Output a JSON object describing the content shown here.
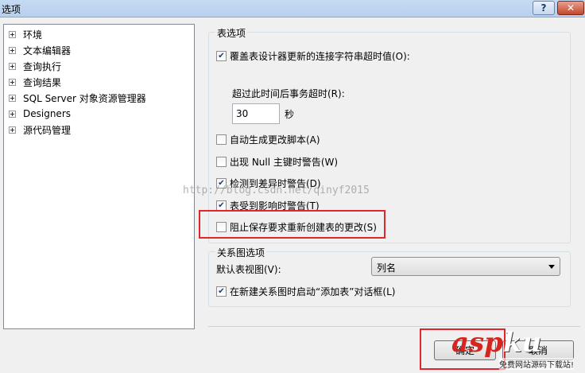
{
  "window": {
    "title": "选项",
    "help_label": "?",
    "close_label": "✕"
  },
  "tree": {
    "items": [
      {
        "label": "环境"
      },
      {
        "label": "文本编辑器"
      },
      {
        "label": "查询执行"
      },
      {
        "label": "查询结果"
      },
      {
        "label": "SQL Server 对象资源管理器"
      },
      {
        "label": "Designers"
      },
      {
        "label": "源代码管理"
      }
    ]
  },
  "table_options": {
    "group_title": "表选项",
    "override_connection_timeout": {
      "label": "覆盖表设计器更新的连接字符串超时值(O):",
      "checked": true
    },
    "timeout_label": "超过此时间后事务超时(R):",
    "timeout_value": "30",
    "timeout_unit": "秒",
    "auto_generate_scripts": {
      "label": "自动生成更改脚本(A)",
      "checked": false
    },
    "null_pk_warning": {
      "label": "出现 Null 主键时警告(W)",
      "checked": false
    },
    "diff_warning": {
      "label": "检测到差异时警告(D)",
      "checked": true
    },
    "affected_tables_warning": {
      "label": "表受到影响时警告(T)",
      "checked": true
    },
    "prevent_saving_changes": {
      "label": "阻止保存要求重新创建表的更改(S)",
      "checked": false
    }
  },
  "diagram_options": {
    "group_title": "关系图选项",
    "default_view_label": "默认表视图(V):",
    "default_view_value": "列名",
    "launch_add_table": {
      "label": "在新建关系图时启动“添加表”对话框(L)",
      "checked": true
    }
  },
  "buttons": {
    "ok_label": "确定",
    "cancel_label": "取消"
  },
  "watermark": {
    "text": "http://blog.csdn.net/qinyf2015"
  },
  "logo": {
    "part1": "asp",
    "part2": "ku",
    "tagline": "免费网站源码下载站!"
  },
  "colors": {
    "highlight": "#e0262a",
    "title_bar": "#b9d1ef",
    "close_button": "#c4462a"
  }
}
